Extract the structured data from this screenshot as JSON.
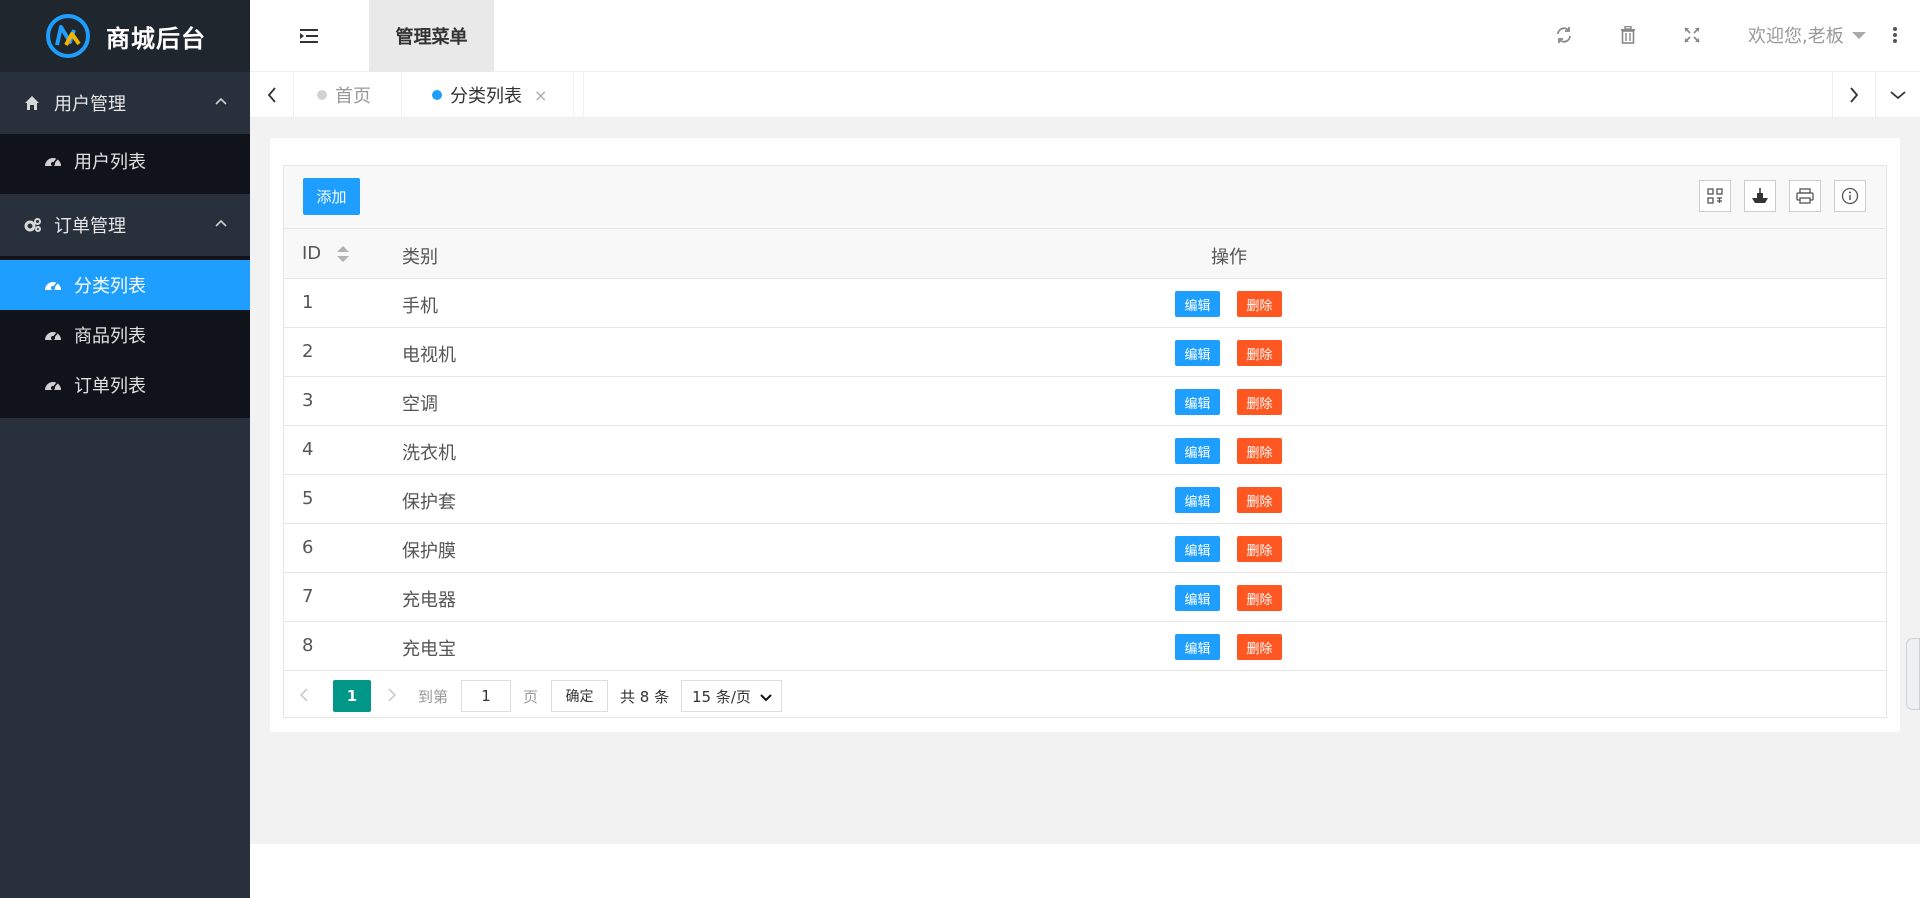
{
  "app": {
    "title": "商城后台"
  },
  "sidebar": {
    "groups": [
      {
        "label": "用户管理",
        "icon": "home-icon",
        "items": [
          {
            "label": "用户列表",
            "icon": "dashboard-icon"
          }
        ]
      },
      {
        "label": "订单管理",
        "icon": "gears-icon",
        "items": [
          {
            "label": "分类列表",
            "icon": "dashboard-icon",
            "active": true
          },
          {
            "label": "商品列表",
            "icon": "dashboard-icon"
          },
          {
            "label": "订单列表",
            "icon": "dashboard-icon"
          }
        ]
      }
    ]
  },
  "header": {
    "menu_tab": "管理菜单",
    "welcome": "欢迎您,老板",
    "icons": [
      "refresh-icon",
      "trash-icon",
      "fullscreen-icon",
      "more-vertical-icon"
    ]
  },
  "tabs": [
    {
      "label": "首页",
      "active": false
    },
    {
      "label": "分类列表",
      "active": true,
      "close": "×"
    }
  ],
  "table": {
    "add_label": "添加",
    "columns": {
      "id": "ID",
      "category": "类别",
      "actions": "操作"
    },
    "edit_label": "编辑",
    "delete_label": "删除",
    "rows": [
      {
        "id": "1",
        "name": "手机"
      },
      {
        "id": "2",
        "name": "电视机"
      },
      {
        "id": "3",
        "name": "空调"
      },
      {
        "id": "4",
        "name": "洗衣机"
      },
      {
        "id": "5",
        "name": "保护套"
      },
      {
        "id": "6",
        "name": "保护膜"
      },
      {
        "id": "7",
        "name": "充电器"
      },
      {
        "id": "8",
        "name": "充电宝"
      }
    ]
  },
  "pager": {
    "current": "1",
    "goto_label": "到第",
    "page_value": "1",
    "page_suffix": "页",
    "confirm": "确定",
    "total": "共 8 条",
    "page_size": "15 条/页"
  },
  "colors": {
    "primary": "#1e9fff",
    "danger": "#ff5722",
    "teal": "#009688",
    "sidebar": "#28303b"
  }
}
